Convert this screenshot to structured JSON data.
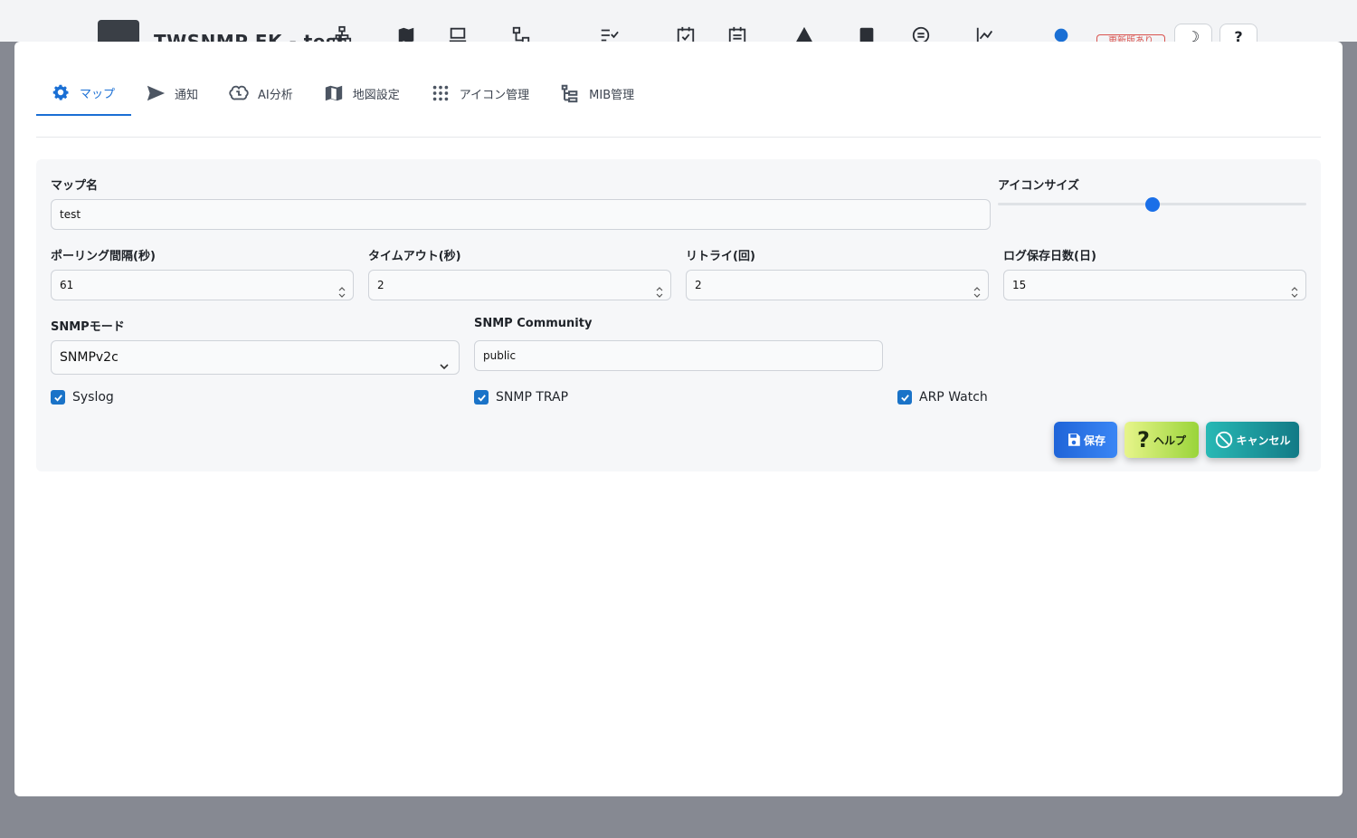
{
  "background": {
    "app_title": "TWSNMP FK - test",
    "update_badge": "更新版あり",
    "icons": [
      "network-icon",
      "map-icon",
      "laptop-icon",
      "diagram-icon",
      "checklist-icon",
      "calendar-check-icon",
      "calendar-icon",
      "warning-icon",
      "clipboard-check-icon",
      "brain-icon",
      "chart-line-icon",
      "gear-icon"
    ],
    "theme_button": "☽",
    "help_button": "?"
  },
  "tabs": [
    {
      "label": "マップ",
      "icon": "gear-icon",
      "active": true
    },
    {
      "label": "通知",
      "icon": "send-icon",
      "active": false
    },
    {
      "label": "AI分析",
      "icon": "brain-icon",
      "active": false
    },
    {
      "label": "地図設定",
      "icon": "map-icon",
      "active": false
    },
    {
      "label": "アイコン管理",
      "icon": "grid-icon",
      "active": false
    },
    {
      "label": "MIB管理",
      "icon": "tree-icon",
      "active": false
    }
  ],
  "form": {
    "map_name": {
      "label": "マップ名",
      "value": "test"
    },
    "icon_size": {
      "label": "アイコンサイズ",
      "value_fraction": 0.5
    },
    "polling": {
      "label": "ポーリング間隔(秒)",
      "value": "61"
    },
    "timeout": {
      "label": "タイムアウト(秒)",
      "value": "2"
    },
    "retry": {
      "label": "リトライ(回)",
      "value": "2"
    },
    "log_days": {
      "label": "ログ保存日数(日)",
      "value": "15"
    },
    "snmp_mode": {
      "label": "SNMPモード",
      "value": "SNMPv2c"
    },
    "snmp_community": {
      "label": "SNMP Community",
      "value": "public"
    },
    "syslog": {
      "label": "Syslog",
      "checked": true
    },
    "snmp_trap": {
      "label": "SNMP TRAP",
      "checked": true
    },
    "arp_watch": {
      "label": "ARP Watch",
      "checked": true
    }
  },
  "buttons": {
    "save": "保存",
    "help": "ヘルプ",
    "cancel": "キャンセル"
  },
  "colors": {
    "accent": "#1a6fd4",
    "checkbox": "#1a73c8",
    "save": "#2b74e8",
    "help": "#b6e25a",
    "cancel": "#1d9ba0"
  }
}
